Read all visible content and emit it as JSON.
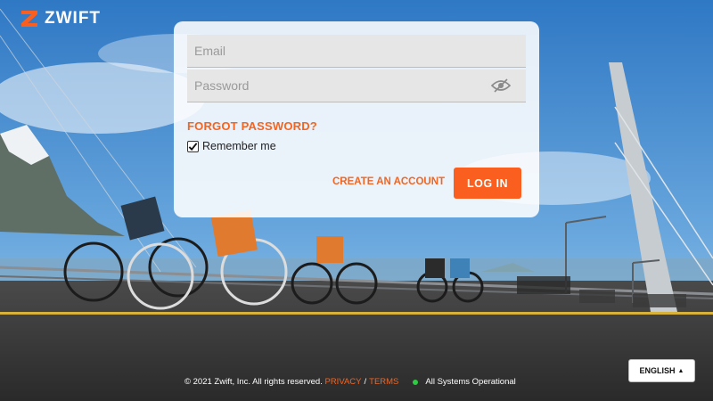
{
  "brand": {
    "name": "ZWIFT",
    "accent": "#fb5f1f",
    "link_color": "#f26522"
  },
  "login": {
    "email_placeholder": "Email",
    "password_placeholder": "Password",
    "forgot_password": "FORGOT PASSWORD?",
    "remember_me": "Remember me",
    "remember_checked": true,
    "create_account": "CREATE AN ACCOUNT",
    "login_button": "LOG IN"
  },
  "footer": {
    "copyright": "© 2021 Zwift, Inc. All rights reserved.",
    "privacy": "PRIVACY",
    "separator": "/",
    "terms": "TERMS",
    "status": "All Systems Operational",
    "status_color": "#2ecc40"
  },
  "language": {
    "selected": "ENGLISH"
  },
  "icons": [
    "zwift-logo-icon",
    "eye-slash-icon",
    "checkmark-icon",
    "caret-up-icon"
  ]
}
